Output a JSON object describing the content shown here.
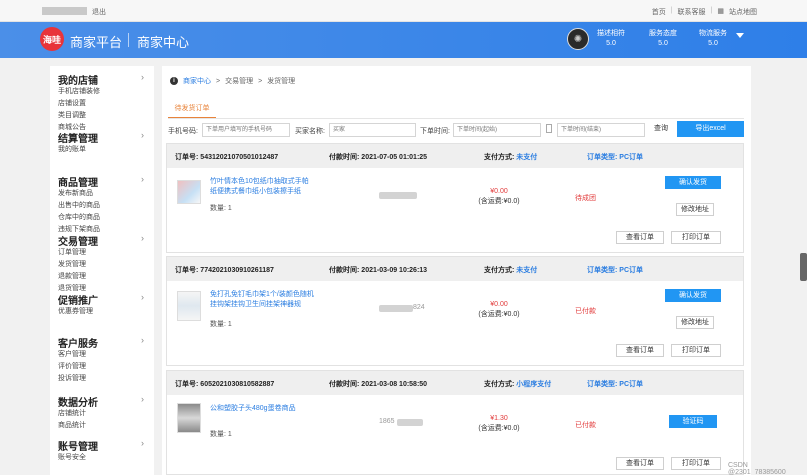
{
  "topbar": {
    "logout": "退出",
    "links": [
      "首页",
      "联系客服",
      "站点地图"
    ]
  },
  "header": {
    "logo_text": "海哇",
    "brand": "商家平台",
    "title": "商家中心",
    "metrics": [
      {
        "label": "描述相符",
        "value": "5.0"
      },
      {
        "label": "服务态度",
        "value": "5.0"
      },
      {
        "label": "物流服务",
        "value": "5.0"
      }
    ]
  },
  "sidebar": {
    "sections": [
      {
        "title": "我的店铺",
        "items": [
          "手机店铺装修",
          "店铺设置",
          "类目调整",
          "商城公告"
        ]
      },
      {
        "title": "结算管理",
        "items": [
          "我的账单"
        ]
      },
      {
        "title": "商品管理",
        "items": [
          "发布新商品",
          "出售中的商品",
          "仓库中的商品",
          "违规下架商品"
        ]
      },
      {
        "title": "交易管理",
        "items": [
          "订单管理",
          "发货管理",
          "退款管理",
          "退货管理"
        ]
      },
      {
        "title": "促销推广",
        "items": [
          "优惠券管理"
        ]
      },
      {
        "title": "客户服务",
        "items": [
          "客户管理",
          "评价管理",
          "投诉管理"
        ]
      },
      {
        "title": "数据分析",
        "items": [
          "店铺统计",
          "商品统计"
        ]
      },
      {
        "title": "账号管理",
        "items": [
          "账号安全"
        ]
      }
    ]
  },
  "breadcrumb": [
    "商家中心",
    ">",
    "交易管理",
    ">",
    "发货管理"
  ],
  "tabs": {
    "active": "待发货订单"
  },
  "filters": {
    "phone_label": "手机号码:",
    "phone_placeholder": "下单用户填写的手机号码",
    "buyer_label": "买家名称:",
    "buyer_placeholder": "买家",
    "time_label": "下单时间:",
    "start_placeholder": "下单时间(起始)",
    "end_placeholder": "下单时间(结束)",
    "query": "查询",
    "export": "导出excel"
  },
  "orders": [
    {
      "no_label": "订单号:",
      "no": "54312021070501012487",
      "time_label": "付款时间:",
      "time": "2021-07-05 01:01:25",
      "pay_label": "支付方式:",
      "pay": "未支付",
      "type_label": "订单类型:",
      "type": "PC订单",
      "goods": "竹叶情本色10包纸巾抽取式手帕纸便携式餐巾纸小包装擦手纸",
      "qty": "数量: 1",
      "masked": "",
      "price": "¥0.00",
      "shipping": "(含运费:¥0.0)",
      "status": "待成团",
      "actions": [
        "确认发货",
        "修改地址"
      ],
      "footer": [
        "查看订单",
        "打印订单"
      ]
    },
    {
      "no_label": "订单号:",
      "no": "7742021030910261187",
      "time_label": "付款时间:",
      "time": "2021-03-09 10:26:13",
      "pay_label": "支付方式:",
      "pay": "未支付",
      "type_label": "订单类型:",
      "type": "PC订单",
      "goods": "免打孔免钉毛巾架1个/装颜色随机挂钩架挂钩卫生间挂架神器规",
      "qty": "数量: 1",
      "masked": "824",
      "price": "¥0.00",
      "shipping": "(含运费:¥0.0)",
      "status": "已付款",
      "actions": [
        "确认发货",
        "修改地址"
      ],
      "footer": [
        "查看订单",
        "打印订单"
      ]
    },
    {
      "no_label": "订单号:",
      "no": "6052021030810582887",
      "time_label": "付款时间:",
      "time": "2021-03-08 10:58:50",
      "pay_label": "支付方式:",
      "pay": "小程序支付",
      "type_label": "订单类型:",
      "type": "PC订单",
      "goods": "公和塑胶子头480g蛋卷商品",
      "qty": "数量: 1",
      "masked": "1865",
      "price": "¥1.30",
      "shipping": "(含运费:¥0.0)",
      "status": "已付款",
      "actions": [
        "验证码"
      ],
      "footer": [
        "查看订单",
        "打印订单"
      ]
    }
  ],
  "watermark": "CSDN @2301_78385600"
}
